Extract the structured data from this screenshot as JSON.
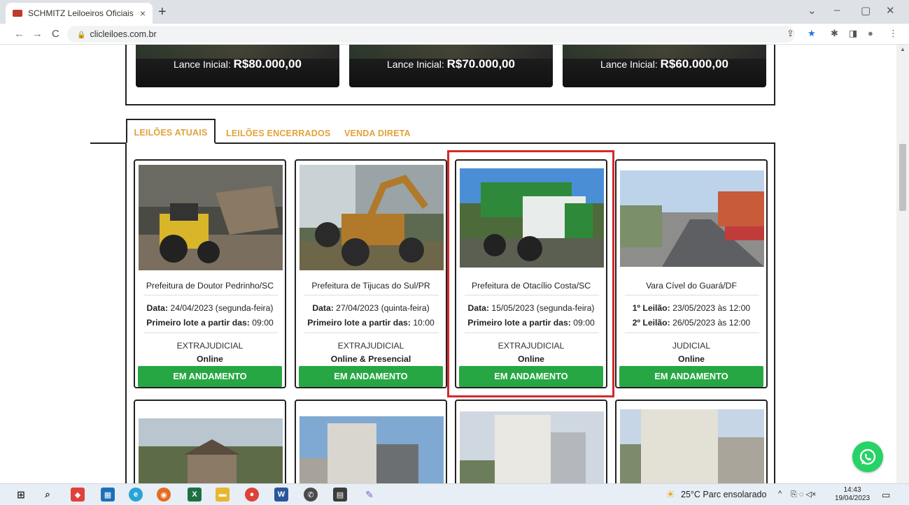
{
  "browser": {
    "tab_title": "SCHMITZ Leiloeiros Oficiais",
    "url": "clicleiloes.com.br",
    "icons": {
      "back": "←",
      "forward": "→",
      "reload": "C",
      "new_tab": "+",
      "close_tab": "×",
      "minimize": "–",
      "maximize": "▢",
      "close_window": "✕",
      "tab_list": "⌄",
      "share": "⇪",
      "star": "★",
      "extensions": "✱",
      "sidepanel": "◨",
      "profile": "●",
      "menu": "⋮"
    }
  },
  "featured": [
    {
      "label": "Lance Inicial:",
      "value": "R$80.000,00"
    },
    {
      "label": "Lance Inicial:",
      "value": "R$70.000,00"
    },
    {
      "label": "Lance Inicial:",
      "value": "R$60.000,00"
    }
  ],
  "section_tabs": [
    "LEILÕES ATUAIS",
    "LEILÕES ENCERRADOS",
    "VENDA DIRETA"
  ],
  "auctions": [
    {
      "title": "Prefeitura de Doutor Pedrinho/SC",
      "line1_label": "Data:",
      "line1_value": " 24/04/2023 (segunda-feira)",
      "line2_label": "Primeiro lote a partir das:",
      "line2_value": " 09:00",
      "type": "EXTRAJUDICIAL",
      "mode": "Online",
      "status": "EM ANDAMENTO"
    },
    {
      "title": "Prefeitura de Tijucas do Sul/PR",
      "line1_label": "Data:",
      "line1_value": " 27/04/2023 (quinta-feira)",
      "line2_label": "Primeiro lote a partir das:",
      "line2_value": " 10:00",
      "type": "EXTRAJUDICIAL",
      "mode": "Online & Presencial",
      "status": "EM ANDAMENTO"
    },
    {
      "title": "Prefeitura de Otacílio Costa/SC",
      "line1_label": "Data:",
      "line1_value": " 15/05/2023 (segunda-feira)",
      "line2_label": "Primeiro lote a partir das:",
      "line2_value": " 09:00",
      "type": "EXTRAJUDICIAL",
      "mode": "Online",
      "status": "EM ANDAMENTO"
    },
    {
      "title": "Vara Cível do Guará/DF",
      "line1_label": "1º Leilão:",
      "line1_value": " 23/05/2023 às 12:00",
      "line2_label": "2º Leilão:",
      "line2_value": " 26/05/2023 às 12:00",
      "type": "JUDICIAL",
      "mode": "Online",
      "status": "EM ANDAMENTO"
    }
  ],
  "taskbar": {
    "weather": "25°C  Parc ensolarado",
    "time": "14:43",
    "date": "19/04/2023"
  },
  "colors": {
    "accent_tab": "#e2a23a",
    "status_button": "#27a744",
    "highlight": "#d42a2a",
    "whatsapp": "#25d366"
  }
}
